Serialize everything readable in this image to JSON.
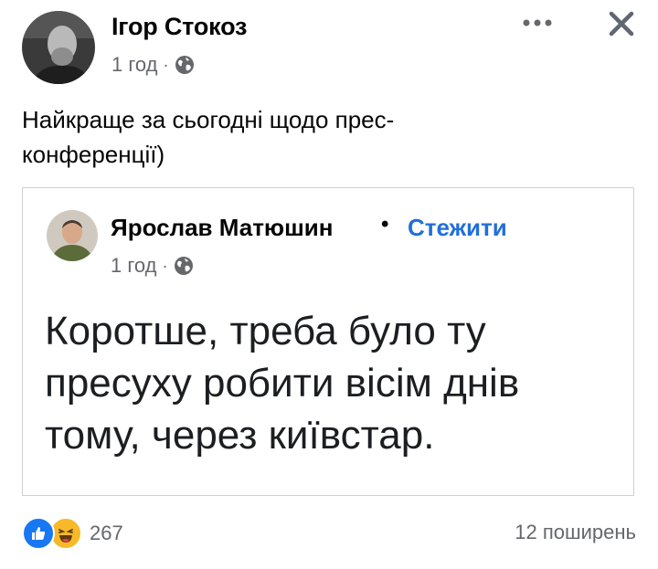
{
  "post": {
    "author_name": "Ігор Стокоз",
    "time": "1 год",
    "separator": "·",
    "text": "Найкраще за сьогодні щодо прес-конференції)"
  },
  "shared_post": {
    "author_name": "Ярослав Матюшин",
    "separator": "•",
    "follow_label": "Стежити",
    "time": "1 год",
    "meta_separator": "·",
    "text": "Коротше, треба було ту пресуху робити вісім днів тому, через київстар."
  },
  "footer": {
    "reaction_count": "267",
    "shares_label": "12 поширень"
  },
  "icons": {
    "more": "more-options-icon",
    "close": "close-icon",
    "privacy": "globe-icon",
    "reactions": [
      "like-icon",
      "haha-icon"
    ]
  },
  "colors": {
    "link": "#216fdb",
    "meta_text": "#65676b",
    "like": "#1877f2",
    "haha": "#f7b928"
  }
}
